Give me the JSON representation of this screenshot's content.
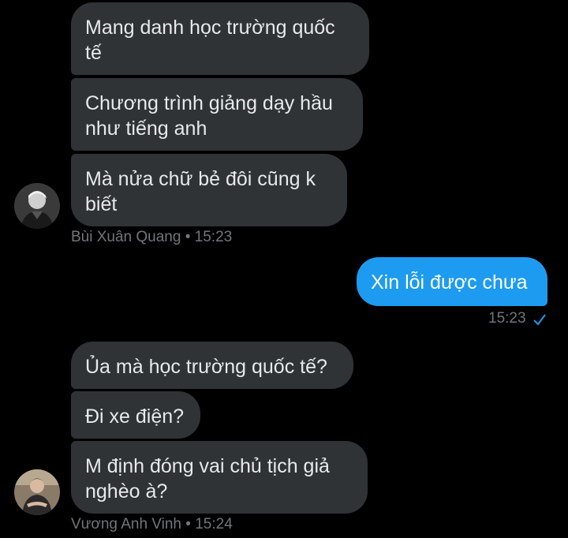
{
  "thread": {
    "group1": {
      "messages": [
        "Mang danh học trường quốc tế",
        "Chương trình giảng dạy hầu như tiếng anh",
        "Mà nửa chữ bẻ đôi cũng k biết"
      ],
      "sender": "Bùi Xuân Quang",
      "separator": "•",
      "time": "15:23",
      "avatar_icon": "user-avatar-photo"
    },
    "outgoing": {
      "message": "Xin lỗi được chưa",
      "time": "15:23",
      "status_icon": "checkmark-icon",
      "bubble_color": "#1d9bf0"
    },
    "group2": {
      "messages": [
        "Ủa mà học trường quốc tế?",
        "Đi xe điện?",
        "M định đóng vai chủ tịch giả nghèo à?"
      ],
      "sender": "Vương Anh Vinh",
      "separator": "•",
      "time": "15:24",
      "avatar_icon": "user-avatar-photo"
    }
  },
  "colors": {
    "background": "#000000",
    "incoming_bubble": "#2f3336",
    "outgoing_bubble": "#1d9bf0",
    "meta_text": "#71767b"
  }
}
